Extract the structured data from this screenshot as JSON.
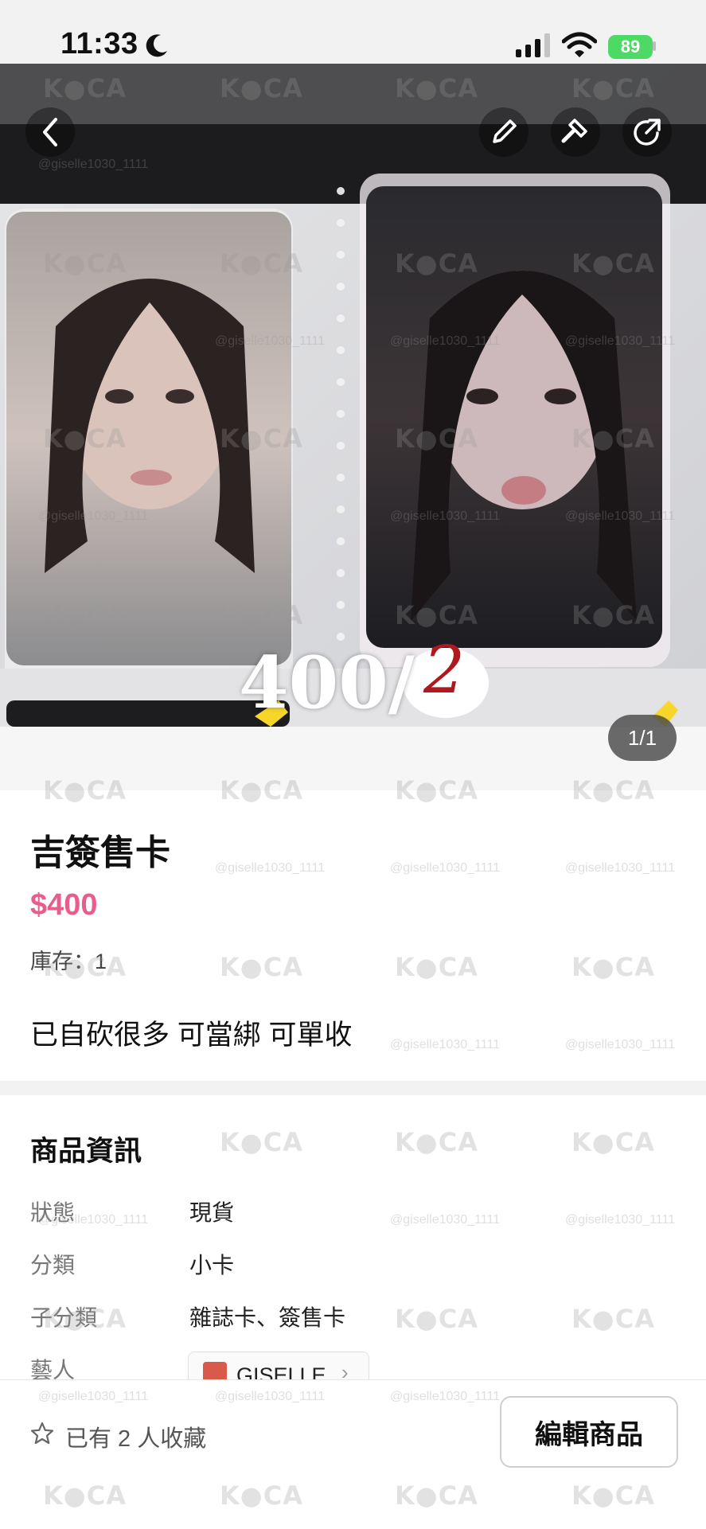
{
  "status_bar": {
    "time": "11:33",
    "battery": "89"
  },
  "photo": {
    "handwritten_price": "400/",
    "handwritten_mark": "2",
    "pager": "1/1"
  },
  "product": {
    "title": "吉簽售卡",
    "price": "$400",
    "stock": "庫存：1",
    "description": "已自砍很多 可當綁 可單收"
  },
  "info": {
    "section_title": "商品資訊",
    "rows": [
      {
        "key": "狀態",
        "value": "現貨"
      },
      {
        "key": "分類",
        "value": "小卡"
      },
      {
        "key": "子分類",
        "value": "雜誌卡、簽售卡"
      },
      {
        "key": "藝人",
        "value": "GISELLE"
      }
    ]
  },
  "bottom_bar": {
    "favorites": "已有 2 人收藏",
    "edit_label": "編輯商品"
  },
  "watermarks": {
    "brand": "KeCA",
    "handle": "@giselle1030_1111"
  },
  "colors": {
    "price": "#e85d8a",
    "battery": "#4cd964"
  }
}
